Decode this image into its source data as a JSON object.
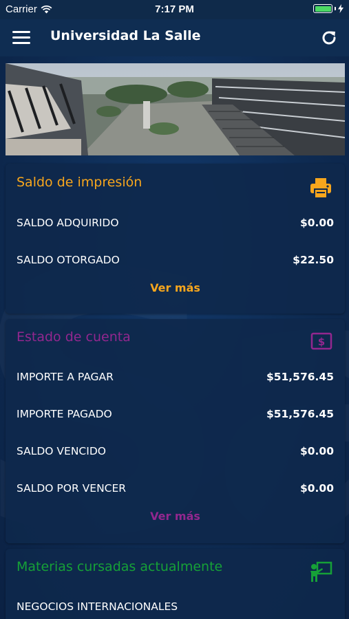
{
  "status_bar": {
    "carrier": "Carrier",
    "time": "7:17 PM"
  },
  "nav": {
    "title": "Universidad La Salle"
  },
  "colors": {
    "orange": "#f7a61d",
    "purple": "#93278f",
    "green": "#16a137",
    "background": "#0f2d52"
  },
  "icons": {
    "menu": "hamburger-icon",
    "refresh": "refresh-icon",
    "print": "printer-icon",
    "account": "dollar-icon",
    "subjects": "teacher-board-icon"
  },
  "print_balance": {
    "title": "Saldo de impresión",
    "rows": [
      {
        "label": "SALDO ADQUIRIDO",
        "value": "$0.00"
      },
      {
        "label": "SALDO OTORGADO",
        "value": "$22.50"
      }
    ],
    "more": "Ver más"
  },
  "account_statement": {
    "title": "Estado de cuenta",
    "rows": [
      {
        "label": "IMPORTE A PAGAR",
        "value": "$51,576.45"
      },
      {
        "label": "IMPORTE PAGADO",
        "value": "$51,576.45"
      },
      {
        "label": "SALDO VENCIDO",
        "value": "$0.00"
      },
      {
        "label": "SALDO POR VENCER",
        "value": "$0.00"
      }
    ],
    "more": "Ver más"
  },
  "current_subjects": {
    "title": "Materias cursadas actualmente",
    "items": [
      "NEGOCIOS INTERNACIONALES"
    ]
  }
}
